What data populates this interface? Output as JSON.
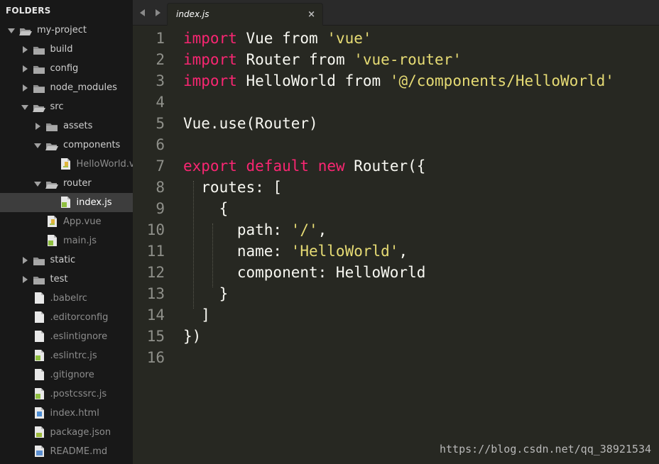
{
  "sidebar": {
    "header": "FOLDERS",
    "items": [
      {
        "label": "my-project",
        "kind": "folder",
        "open": true,
        "depth": 0
      },
      {
        "label": "build",
        "kind": "folder",
        "open": false,
        "depth": 1
      },
      {
        "label": "config",
        "kind": "folder",
        "open": false,
        "depth": 1
      },
      {
        "label": "node_modules",
        "kind": "folder",
        "open": false,
        "depth": 1
      },
      {
        "label": "src",
        "kind": "folder",
        "open": true,
        "depth": 1
      },
      {
        "label": "assets",
        "kind": "folder",
        "open": false,
        "depth": 2
      },
      {
        "label": "components",
        "kind": "folder",
        "open": true,
        "depth": 2
      },
      {
        "label": "HelloWorld.vue",
        "kind": "file",
        "icon": "vue",
        "depth": 3
      },
      {
        "label": "router",
        "kind": "folder",
        "open": true,
        "depth": 2
      },
      {
        "label": "index.js",
        "kind": "file",
        "icon": "js",
        "depth": 3,
        "selected": true
      },
      {
        "label": "App.vue",
        "kind": "file",
        "icon": "vue",
        "depth": 2
      },
      {
        "label": "main.js",
        "kind": "file",
        "icon": "js",
        "depth": 2
      },
      {
        "label": "static",
        "kind": "folder",
        "open": false,
        "depth": 1
      },
      {
        "label": "test",
        "kind": "folder",
        "open": false,
        "depth": 1
      },
      {
        "label": ".babelrc",
        "kind": "file",
        "icon": "plain",
        "depth": 1
      },
      {
        "label": ".editorconfig",
        "kind": "file",
        "icon": "plain",
        "depth": 1
      },
      {
        "label": ".eslintignore",
        "kind": "file",
        "icon": "plain",
        "depth": 1
      },
      {
        "label": ".eslintrc.js",
        "kind": "file",
        "icon": "js",
        "depth": 1
      },
      {
        "label": ".gitignore",
        "kind": "file",
        "icon": "plain",
        "depth": 1
      },
      {
        "label": ".postcssrc.js",
        "kind": "file",
        "icon": "js",
        "depth": 1
      },
      {
        "label": "index.html",
        "kind": "file",
        "icon": "html",
        "depth": 1
      },
      {
        "label": "package.json",
        "kind": "file",
        "icon": "json",
        "depth": 1
      },
      {
        "label": "README.md",
        "kind": "file",
        "icon": "md",
        "depth": 1
      }
    ]
  },
  "tab": {
    "label": "index.js",
    "close": "×"
  },
  "code": {
    "lines": [
      {
        "n": "1",
        "tokens": [
          {
            "t": "import",
            "c": "kw"
          },
          {
            "t": " Vue ",
            "c": "pl"
          },
          {
            "t": "from",
            "c": "pl"
          },
          {
            "t": " ",
            "c": "pl"
          },
          {
            "t": "'vue'",
            "c": "str"
          }
        ]
      },
      {
        "n": "2",
        "tokens": [
          {
            "t": "import",
            "c": "kw"
          },
          {
            "t": " Router ",
            "c": "pl"
          },
          {
            "t": "from",
            "c": "pl"
          },
          {
            "t": " ",
            "c": "pl"
          },
          {
            "t": "'vue-router'",
            "c": "str"
          }
        ]
      },
      {
        "n": "3",
        "tokens": [
          {
            "t": "import",
            "c": "kw"
          },
          {
            "t": " HelloWorld ",
            "c": "pl"
          },
          {
            "t": "from",
            "c": "pl"
          },
          {
            "t": " ",
            "c": "pl"
          },
          {
            "t": "'@/components/HelloWorld'",
            "c": "str"
          }
        ]
      },
      {
        "n": "4",
        "tokens": []
      },
      {
        "n": "5",
        "tokens": [
          {
            "t": "Vue.use(Router)",
            "c": "pl"
          }
        ]
      },
      {
        "n": "6",
        "tokens": []
      },
      {
        "n": "7",
        "tokens": [
          {
            "t": "export",
            "c": "kw"
          },
          {
            "t": " ",
            "c": "pl"
          },
          {
            "t": "default",
            "c": "kw"
          },
          {
            "t": " ",
            "c": "pl"
          },
          {
            "t": "new",
            "c": "kw"
          },
          {
            "t": " Router({",
            "c": "pl"
          }
        ]
      },
      {
        "n": "8",
        "tokens": [
          {
            "t": "  routes: [",
            "c": "pl"
          }
        ]
      },
      {
        "n": "9",
        "tokens": [
          {
            "t": "    {",
            "c": "pl"
          }
        ]
      },
      {
        "n": "10",
        "tokens": [
          {
            "t": "      path: ",
            "c": "pl"
          },
          {
            "t": "'/'",
            "c": "str"
          },
          {
            "t": ",",
            "c": "pl"
          }
        ]
      },
      {
        "n": "11",
        "tokens": [
          {
            "t": "      name: ",
            "c": "pl"
          },
          {
            "t": "'HelloWorld'",
            "c": "str"
          },
          {
            "t": ",",
            "c": "pl"
          }
        ]
      },
      {
        "n": "12",
        "tokens": [
          {
            "t": "      component: HelloWorld",
            "c": "pl"
          }
        ]
      },
      {
        "n": "13",
        "tokens": [
          {
            "t": "    }",
            "c": "pl"
          }
        ]
      },
      {
        "n": "14",
        "tokens": [
          {
            "t": "  ]",
            "c": "pl"
          }
        ]
      },
      {
        "n": "15",
        "tokens": [
          {
            "t": "})",
            "c": "pl"
          }
        ]
      },
      {
        "n": "16",
        "tokens": []
      }
    ]
  },
  "watermark": "https://blog.csdn.net/qq_38921534",
  "colors": {
    "keyword": "#f92672",
    "string": "#e6db74",
    "text": "#f8f8f2",
    "background": "#272822",
    "sidebar": "#181818"
  }
}
